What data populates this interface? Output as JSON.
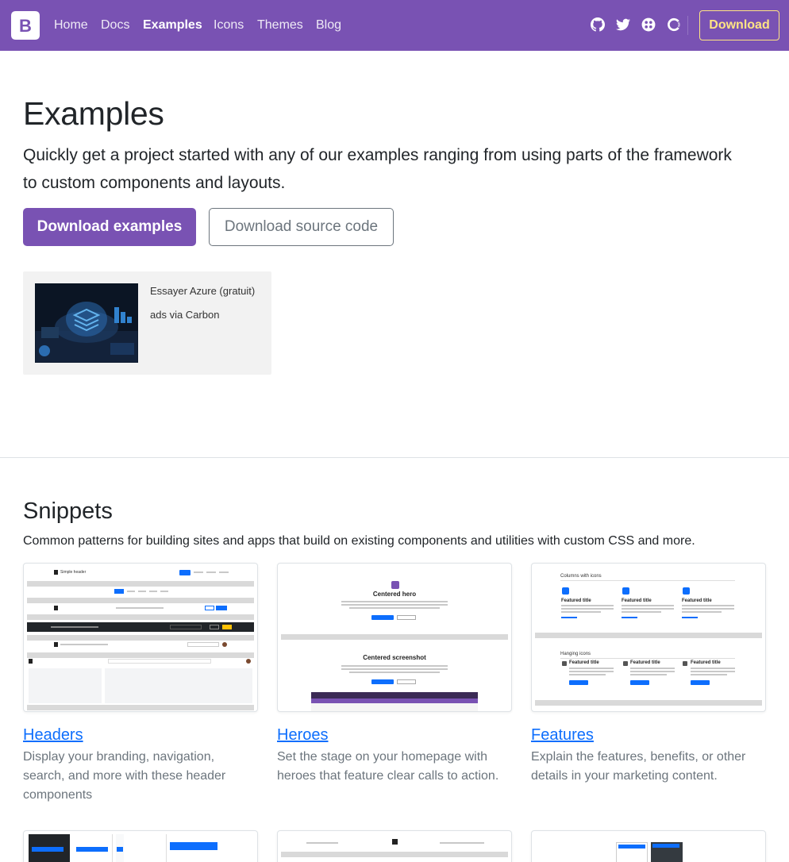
{
  "navbar": {
    "brand_letter": "B",
    "links": [
      "Home",
      "Docs",
      "Examples",
      "Icons",
      "Themes",
      "Blog"
    ],
    "active_link": "Examples",
    "social_icons": [
      "github-icon",
      "twitter-icon",
      "opencollective-icon",
      "slack-icon"
    ],
    "download_label": "Download",
    "colors": {
      "background": "#7952b3",
      "download_accent": "#ffe484"
    }
  },
  "intro": {
    "title": "Examples",
    "lead": "Quickly get a project started with any of our examples ranging from using parts of the framework to custom components and layouts.",
    "primary_button": "Download examples",
    "secondary_button": "Download source code"
  },
  "ad": {
    "text": "Essayer Azure (gratuit)",
    "poweredby": "ads via Carbon"
  },
  "snippets": {
    "title": "Snippets",
    "description": "Common patterns for building sites and apps that build on existing components and utilities with custom CSS and more.",
    "cards": [
      {
        "title": "Headers",
        "description": "Display your branding, navigation, search, and more with these header components"
      },
      {
        "title": "Heroes",
        "description": "Set the stage on your homepage with heroes that feature clear calls to action."
      },
      {
        "title": "Features",
        "description": "Explain the features, benefits, or other details in your marketing content."
      }
    ],
    "thumb_text": {
      "headers_brand": "Simple header",
      "heroes_1": "Centered hero",
      "heroes_2": "Centered screenshot",
      "features_1": "Columns with icons",
      "features_2": "Hanging icons",
      "featured_title": "Featured title"
    }
  }
}
